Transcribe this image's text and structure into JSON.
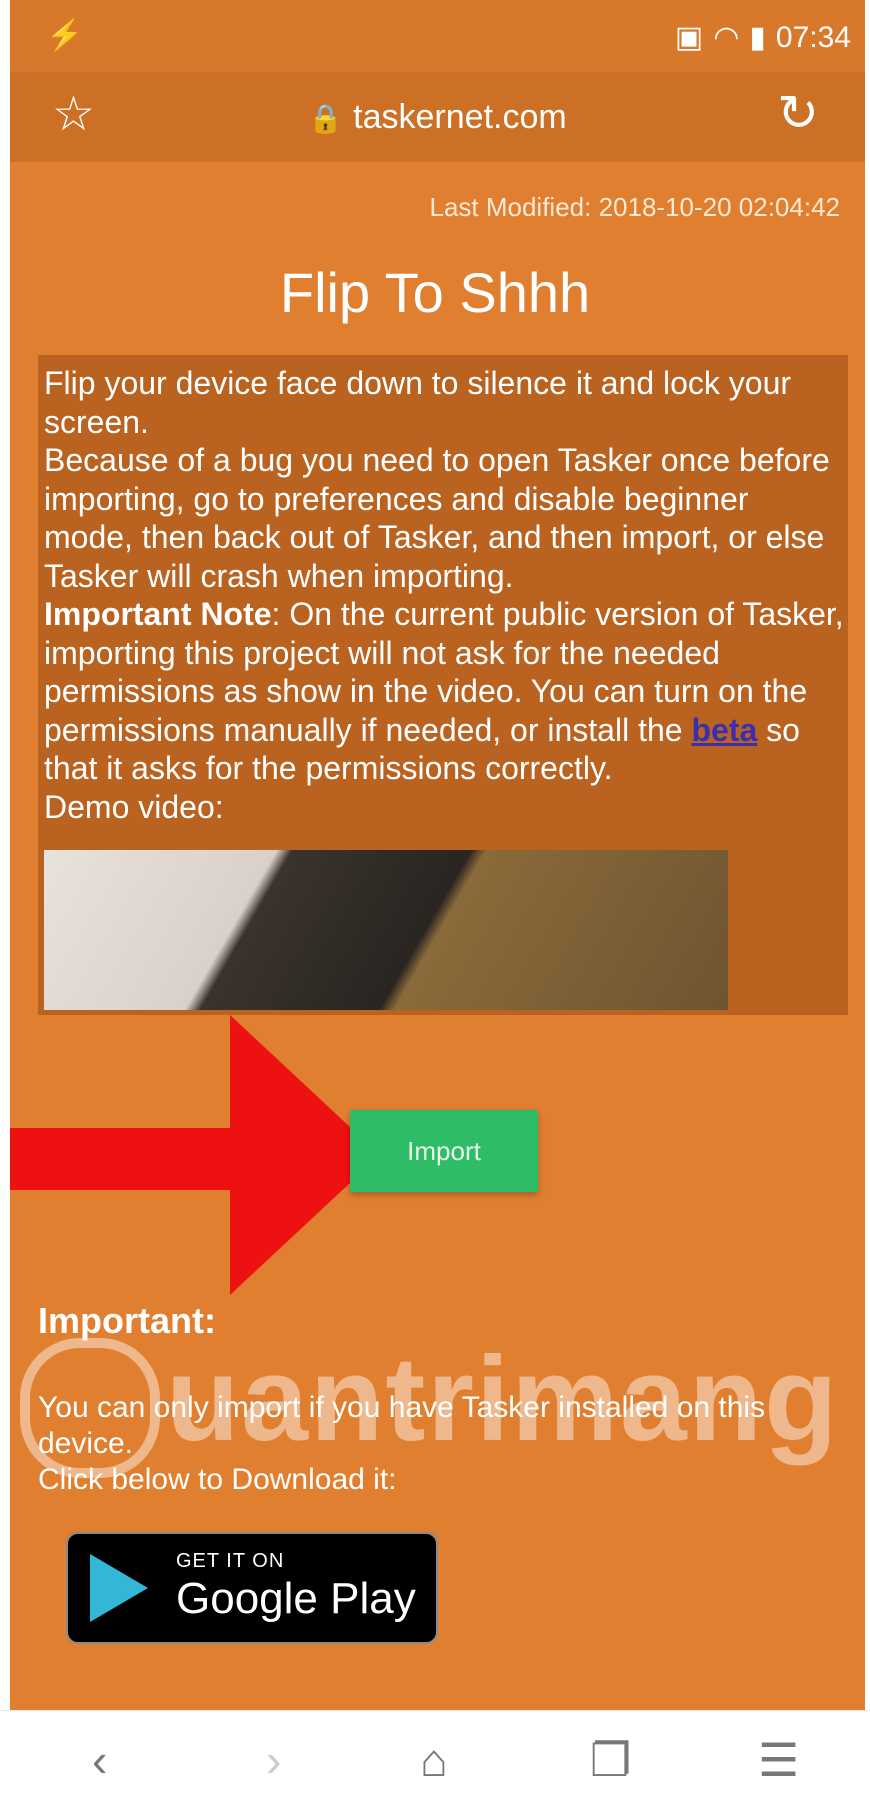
{
  "status_bar": {
    "time": "07:34"
  },
  "browser": {
    "url": "taskernet.com"
  },
  "page": {
    "last_modified": "Last Modified: 2018-10-20 02:04:42",
    "title": "Flip To Shhh",
    "description": {
      "line1": "Flip your device face down to silence it and lock your screen.",
      "line2": "Because of a bug you need to open Tasker once before importing, go to preferences and disable beginner mode, then back out of Tasker, and then import, or else Tasker will crash when importing.",
      "important_label": "Important Note",
      "important_text": ": On the current public version of Tasker, importing this project will not ask for the needed permissions as show in the video. You can turn on the permissions manually if needed, or install the ",
      "beta_link": "beta",
      "tail": " so that it asks for the permissions correctly.",
      "demo": "Demo video:"
    },
    "import_button": "Import",
    "important_heading": "Important:",
    "install_text": "You can only import if you have Tasker installed on this device.",
    "download_text": "Click below to Download it:"
  },
  "google_play": {
    "small": "GET IT ON",
    "big": "Google Play"
  },
  "watermark": "uantrimang",
  "colors": {
    "page_bg": "#e07f2f",
    "import_button": "#2ebd66",
    "arrow": "#ee1111"
  }
}
